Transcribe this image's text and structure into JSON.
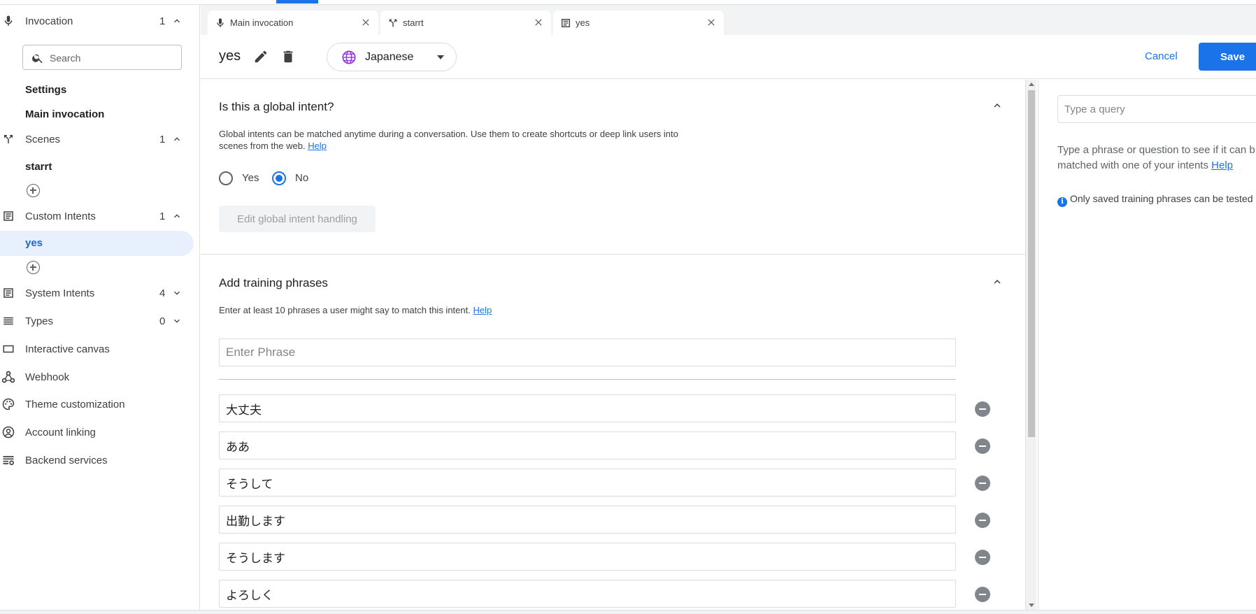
{
  "sidebar": {
    "invocation": {
      "label": "Invocation",
      "count": "1",
      "icon": "mic-icon"
    },
    "search": {
      "placeholder": "Search"
    },
    "invocation_items": [
      "Settings",
      "Main invocation"
    ],
    "scenes": {
      "label": "Scenes",
      "count": "1",
      "icon": "scenes-icon"
    },
    "scene_items": [
      "starrt"
    ],
    "custom_intents": {
      "label": "Custom Intents",
      "count": "1",
      "icon": "list-icon"
    },
    "custom_intent_items": [
      "yes"
    ],
    "system_intents": {
      "label": "System Intents",
      "count": "4",
      "icon": "list-icon"
    },
    "types": {
      "label": "Types",
      "count": "0",
      "icon": "types-icon"
    },
    "links": [
      {
        "label": "Interactive canvas",
        "icon": "canvas-icon"
      },
      {
        "label": "Webhook",
        "icon": "webhook-icon"
      },
      {
        "label": "Theme customization",
        "icon": "palette-icon"
      },
      {
        "label": "Account linking",
        "icon": "account-icon"
      },
      {
        "label": "Backend services",
        "icon": "backend-icon"
      }
    ]
  },
  "tabs": [
    {
      "label": "Main invocation",
      "icon": "mic-icon"
    },
    {
      "label": "starrt",
      "icon": "scenes-icon"
    },
    {
      "label": "yes",
      "icon": "list-icon"
    }
  ],
  "header": {
    "title": "yes",
    "language": "Japanese",
    "cancel_label": "Cancel",
    "save_label": "Save"
  },
  "global_intent": {
    "title": "Is this a global intent?",
    "description": "Global intents can be matched anytime during a conversation. Use them to create shortcuts or deep link users into",
    "description_line2": "scenes from the web.",
    "help_label": "Help",
    "yes_label": "Yes",
    "no_label": "No",
    "selected": "No",
    "edit_button_label": "Edit global intent handling"
  },
  "training": {
    "title": "Add training phrases",
    "description": "Enter at least 10 phrases a user might say to match this intent.",
    "help_label": "Help",
    "input_placeholder": "Enter Phrase",
    "phrases": [
      "大丈夫",
      "ああ",
      "そうして",
      "出勤します",
      "そうします",
      "よろしく"
    ]
  },
  "test_panel": {
    "query_placeholder": "Type a query",
    "description_line1": "Type a phrase or question to see if it can b",
    "description_line2": "matched with one of your intents",
    "help_label": "Help",
    "note": "Only saved training phrases can be tested"
  },
  "colors": {
    "accent": "#1a73e8",
    "active_bg": "#e8f0fe"
  }
}
